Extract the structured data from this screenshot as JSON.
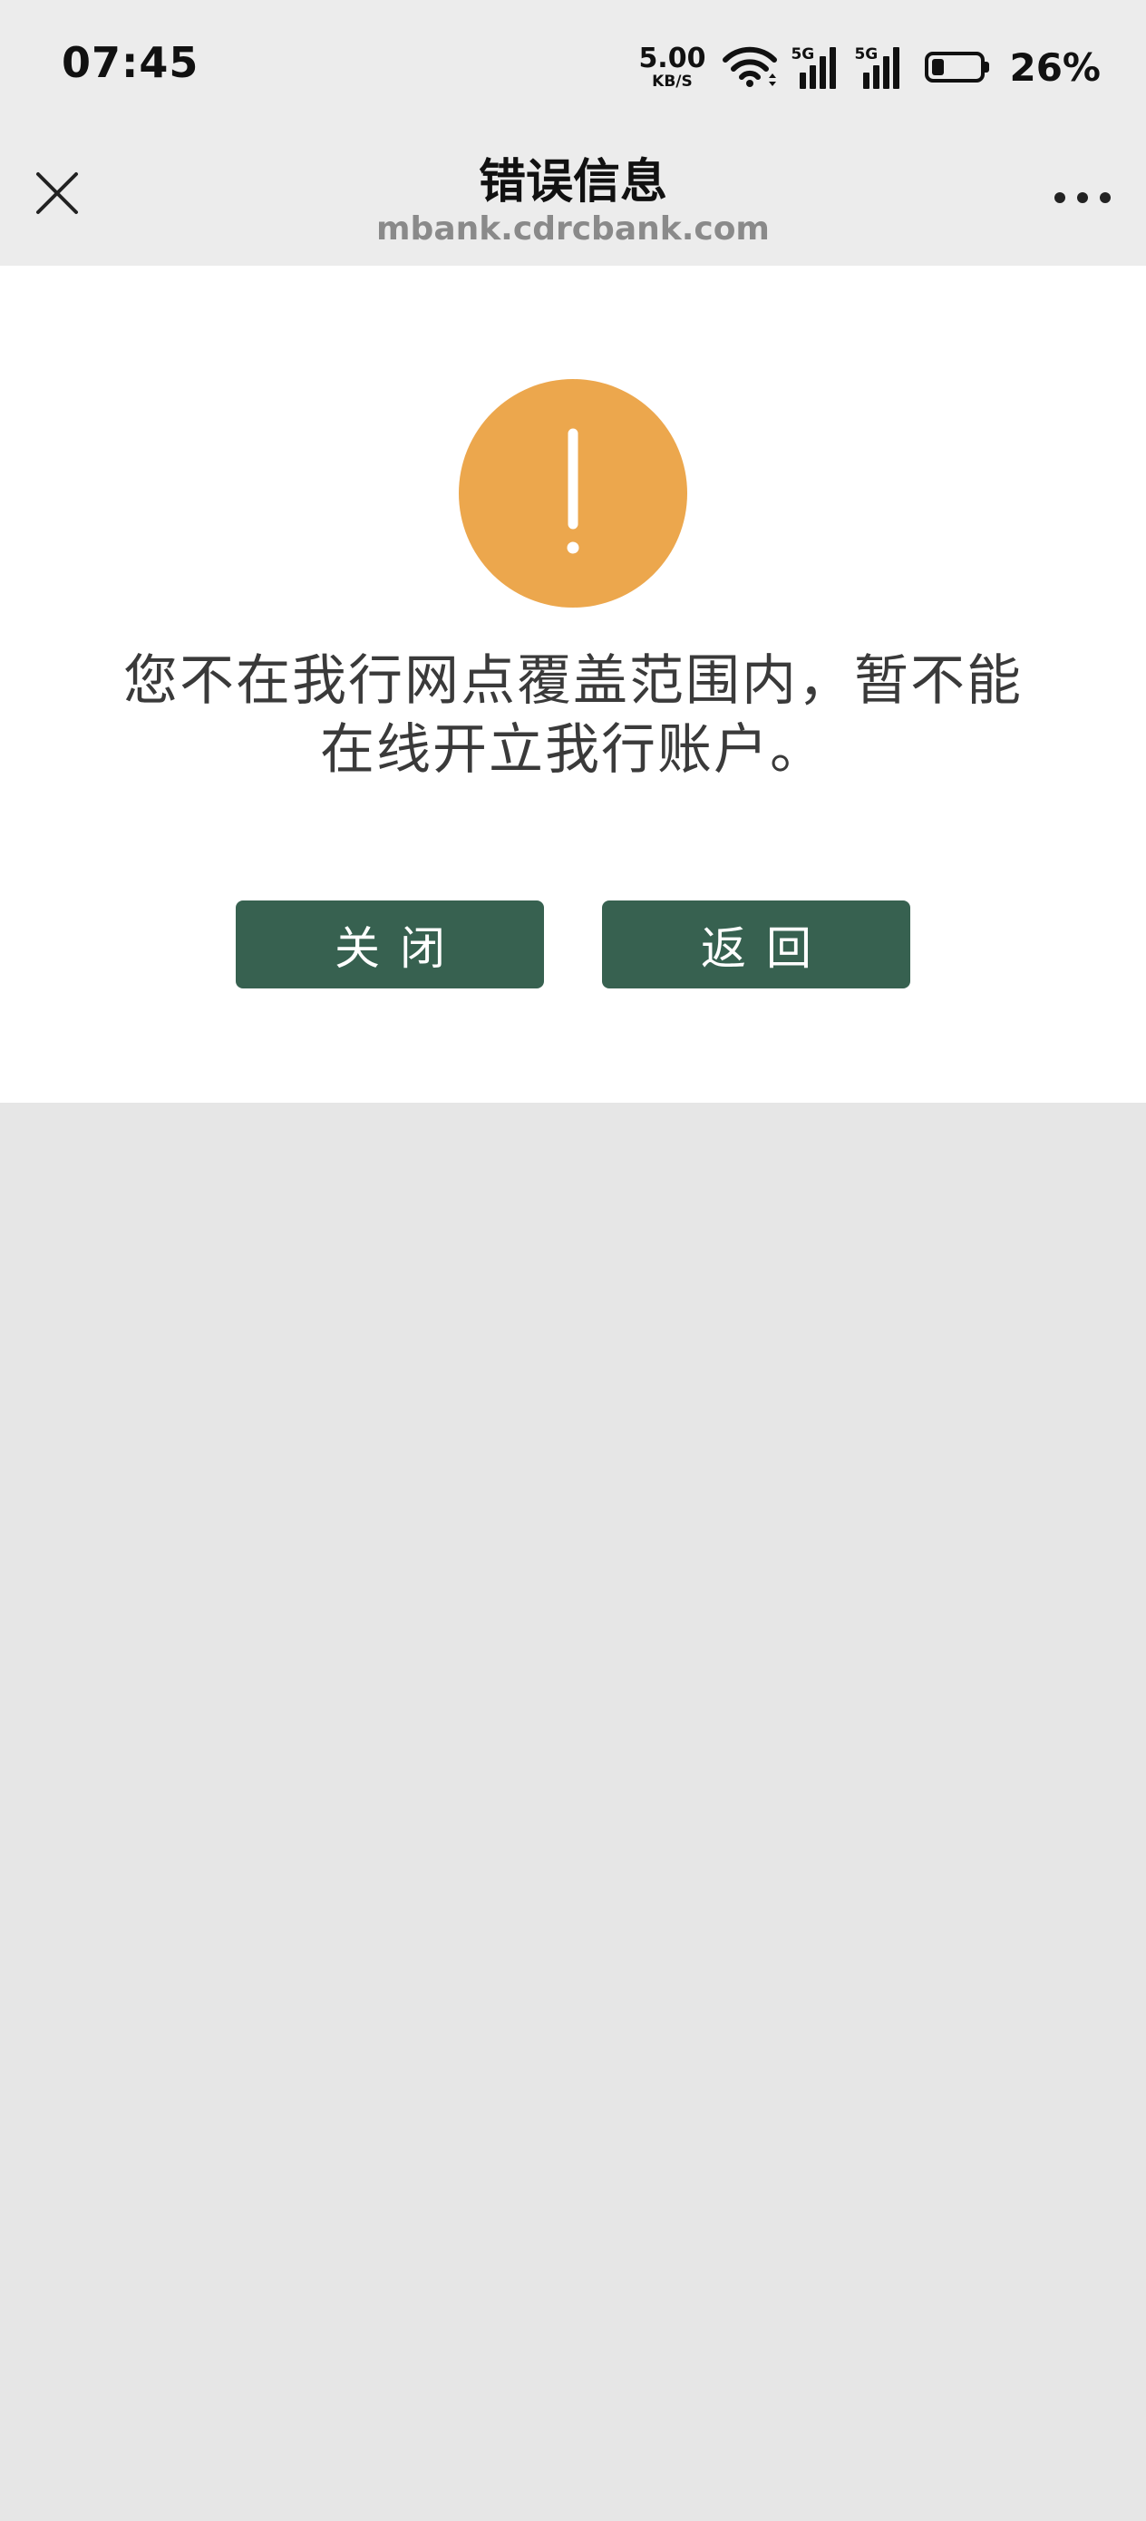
{
  "status_bar": {
    "time": "07:45",
    "net_speed_value": "5.00",
    "net_speed_unit": "KB/S",
    "signal_1_tag": "5G",
    "signal_2_tag": "5G",
    "battery_percent": "26%",
    "battery_level": 0.26
  },
  "nav": {
    "title": "错误信息",
    "subtitle": "mbank.cdrcbank.com"
  },
  "content": {
    "message_line1": "您不在我行网点覆盖范围内，暂不能",
    "message_line2": "在线开立我行账户。",
    "close_button_label": "关闭",
    "back_button_label": "返回"
  },
  "colors": {
    "warning": "#eca74d",
    "button": "#376150",
    "background": "#e6e6e6",
    "nav_background": "#ececec"
  },
  "icons": {
    "close": "close-icon",
    "more": "more-icon",
    "warning": "exclamation-icon",
    "wifi": "wifi-icon",
    "battery": "battery-icon"
  }
}
